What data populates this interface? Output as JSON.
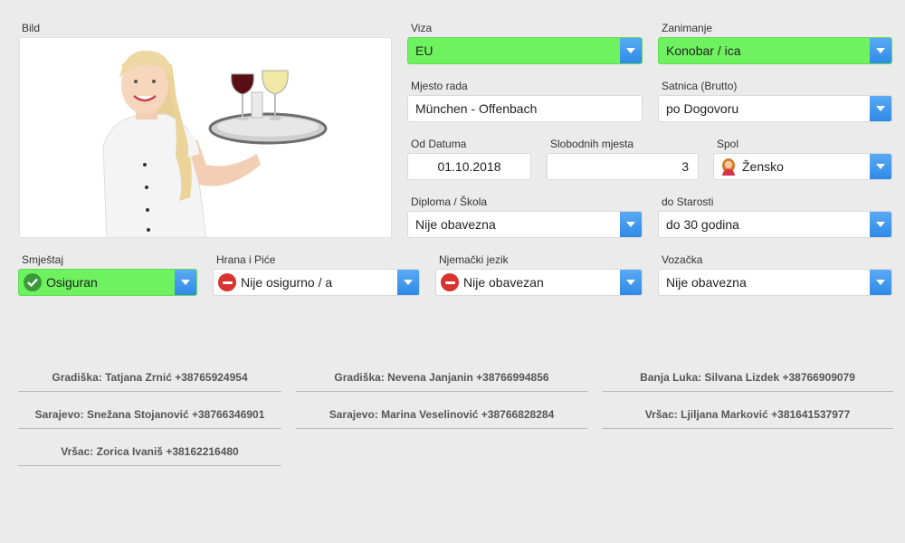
{
  "photo": {
    "label": "Bild"
  },
  "viza": {
    "label": "Viza",
    "value": "EU"
  },
  "zanimanje": {
    "label": "Zanimanje",
    "value": "Konobar / ica"
  },
  "mjesto_rada": {
    "label": "Mjesto rada",
    "value": "München - Offenbach"
  },
  "satnica": {
    "label": "Satnica (Brutto)",
    "value": "po Dogovoru"
  },
  "od_datuma": {
    "label": "Od Datuma",
    "value": "01.10.2018"
  },
  "slobodnih_mjesta": {
    "label": "Slobodnih mjesta",
    "value": "3"
  },
  "spol": {
    "label": "Spol",
    "value": "Žensko"
  },
  "diploma": {
    "label": "Diploma / Škola",
    "value": "Nije obavezna"
  },
  "do_starosti": {
    "label": "do Starosti",
    "value": "do 30 godina"
  },
  "smjestaj": {
    "label": "Smještaj",
    "value": "Osiguran"
  },
  "hrana": {
    "label": "Hrana i Piće",
    "value": "Nije osigurno / a"
  },
  "njemacki": {
    "label": "Njemački jezik",
    "value": "Nije obavezan"
  },
  "vozacka": {
    "label": "Vozačka",
    "value": "Nije obavezna"
  },
  "contacts": [
    "Gradiška: Tatjana Zrnić +38765924954",
    "Gradiška: Nevena Janjanin +38766994856",
    "Banja Luka: Silvana Lizdek +38766909079",
    "Sarajevo: Snežana Stojanović +38766346901",
    "Sarajevo: Marina Veselinović +38766828284",
    "Vršac: Ljiljana Marković +381641537977",
    "Vršac: Zorica Ivaniš +38162216480"
  ],
  "colors": {
    "accent_green": "#6ef25f",
    "dropdown_blue": "#3b92ec",
    "no_red": "#d9332f",
    "ok_green": "#3a9a3a"
  },
  "icons": {
    "ok": "check-circle-icon",
    "no": "no-entry-icon",
    "gender": "female-avatar-icon",
    "dropdown": "chevron-down-icon"
  }
}
